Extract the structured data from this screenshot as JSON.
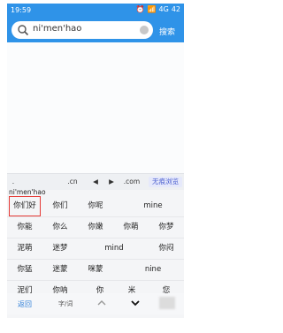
{
  "status": {
    "time": "19:59",
    "signal_text": "4G",
    "battery": "42"
  },
  "search": {
    "query": "ni'men'hao",
    "button_label": "搜索"
  },
  "url_bar": {
    "keys": [
      ".cn",
      "◀",
      "▶",
      ".com"
    ],
    "incognito_label": "无痕浏览"
  },
  "ime": {
    "pinyin": "ni'men'hao",
    "rows": [
      [
        {
          "text": "你们好",
          "selected": true
        },
        {
          "text": "你们"
        },
        {
          "text": "你呢"
        },
        {
          "text": "mine"
        }
      ],
      [
        {
          "text": "你能"
        },
        {
          "text": "你么"
        },
        {
          "text": "你嫩"
        },
        {
          "text": "你萌"
        },
        {
          "text": "你梦"
        }
      ],
      [
        {
          "text": "泥萌"
        },
        {
          "text": "迷梦"
        },
        {
          "text": "mind"
        },
        {
          "text": "你闷"
        }
      ],
      [
        {
          "text": "你猛"
        },
        {
          "text": "迷蒙"
        },
        {
          "text": "咪蒙"
        },
        {
          "text": "nine"
        }
      ],
      [
        {
          "text": "泥们"
        },
        {
          "text": "你呐"
        },
        {
          "text": "你"
        },
        {
          "text": "米"
        },
        {
          "text": "您"
        }
      ]
    ],
    "bottom": {
      "back_label": "返回",
      "mode_label": "字/词"
    }
  }
}
